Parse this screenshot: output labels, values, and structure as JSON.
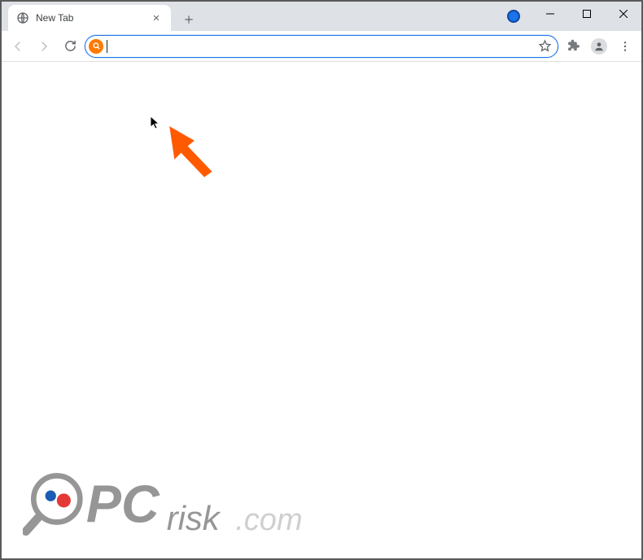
{
  "tab": {
    "title": "New Tab"
  },
  "omnibox": {
    "value": "",
    "placeholder": ""
  },
  "watermark": {
    "text_pc": "PC",
    "text_risk": "risk",
    "text_dotcom": ".com"
  },
  "colors": {
    "accent": "#1a73e8",
    "arrow": "#ff5a00",
    "logo_gray": "#969696",
    "logo_dot_blue": "#1a5db4",
    "logo_dot_red": "#e53935"
  }
}
